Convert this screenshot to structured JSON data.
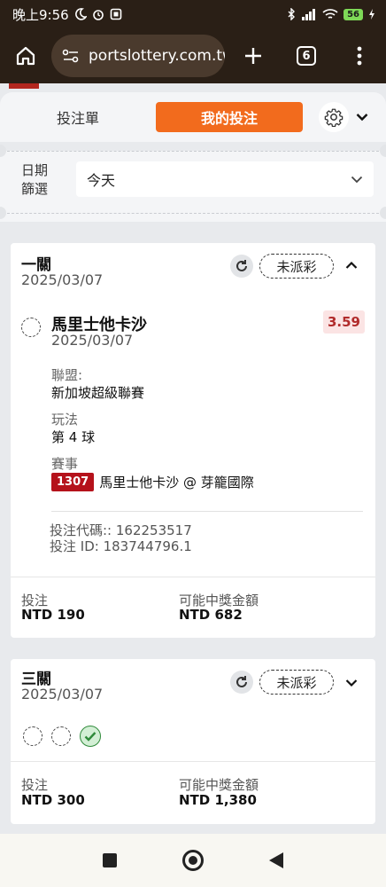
{
  "status_bar": {
    "time": "晚上9:56",
    "battery": "56"
  },
  "browser": {
    "url": "portslottery.com.tw",
    "tab_count": "6"
  },
  "header_tabs": {
    "bet_slip": "投注單",
    "my_bets": "我的投注"
  },
  "filter": {
    "label_line1": "日期",
    "label_line2": "篩選",
    "value": "今天"
  },
  "bets": [
    {
      "title": "一關",
      "date": "2025/03/07",
      "status": "未派彩",
      "selection": {
        "team": "馬里士他卡沙",
        "date": "2025/03/07",
        "odds": "3.59",
        "league_label": "聯盟:",
        "league": "新加坡超級聯賽",
        "market_label": "玩法",
        "market": "第 4 球",
        "event_label": "賽事",
        "event_code": "1307",
        "event_name": "馬里士他卡沙 @ 芽籠國際"
      },
      "bet_code_line": "投注代碼:: 162253517",
      "bet_id_line": "投注 ID: 183744796.1",
      "stake_label": "投注",
      "stake": "NTD 190",
      "payout_label": "可能中獎金額",
      "payout": "NTD 682"
    },
    {
      "title": "三關",
      "date": "2025/03/07",
      "status": "未派彩",
      "legs": [
        "pending",
        "pending",
        "won"
      ],
      "stake_label": "投注",
      "stake": "NTD 300",
      "payout_label": "可能中獎金額",
      "payout": "NTD 1,380"
    }
  ],
  "colors": {
    "accent": "#f26b1d",
    "odds_text": "#b12b2b",
    "event_code_bg": "#b5121b",
    "won_green": "#2f8a3a"
  }
}
